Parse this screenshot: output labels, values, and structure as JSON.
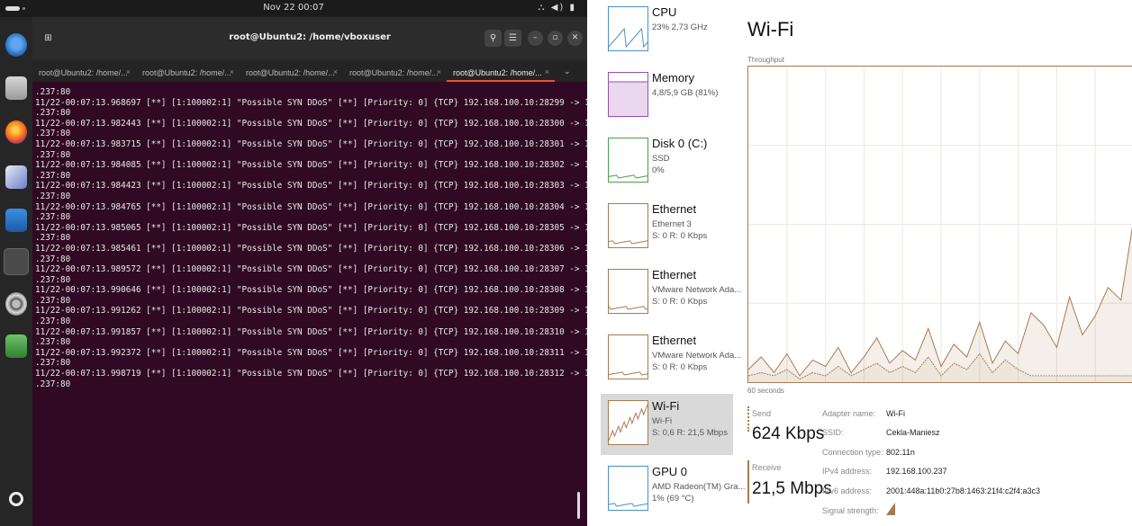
{
  "ubuntu": {
    "clock": "Nov 22 00:07",
    "tray": "⛬ ◀) ▮",
    "window_title": "root@Ubuntu2: /home/vboxuser",
    "tabs": [
      {
        "label": "root@Ubuntu2: /home/...",
        "active": false
      },
      {
        "label": "root@Ubuntu2: /home/...",
        "active": false
      },
      {
        "label": "root@Ubuntu2: /home/...",
        "active": false
      },
      {
        "label": "root@Ubuntu2: /home/...",
        "active": false
      },
      {
        "label": "root@Ubuntu2: /home/...",
        "active": true
      }
    ],
    "tab_more": "⌄",
    "buttons": {
      "newtab": "⊞",
      "search": "⚲",
      "menu": "☰",
      "min": "–",
      "max": "▫",
      "close": "✕"
    },
    "first_line": ".237:80",
    "lines": [
      {
        "ts": "11/22-00:07:13.968697",
        "port": "28299"
      },
      {
        "ts": "11/22-00:07:13.982443",
        "port": "28300"
      },
      {
        "ts": "11/22-00:07:13.983715",
        "port": "28301"
      },
      {
        "ts": "11/22-00:07:13.984085",
        "port": "28302"
      },
      {
        "ts": "11/22-00:07:13.984423",
        "port": "28303"
      },
      {
        "ts": "11/22-00:07:13.984765",
        "port": "28304"
      },
      {
        "ts": "11/22-00:07:13.985065",
        "port": "28305"
      },
      {
        "ts": "11/22-00:07:13.985461",
        "port": "28306"
      },
      {
        "ts": "11/22-00:07:13.989572",
        "port": "28307"
      },
      {
        "ts": "11/22-00:07:13.990646",
        "port": "28308"
      },
      {
        "ts": "11/22-00:07:13.991262",
        "port": "28309"
      },
      {
        "ts": "11/22-00:07:13.991857",
        "port": "28310"
      },
      {
        "ts": "11/22-00:07:13.992372",
        "port": "28311"
      },
      {
        "ts": "11/22-00:07:13.998719",
        "port": "28312"
      }
    ],
    "alert_text": " [**] [1:100002:1] \"Possible SYN DDoS\" [**] [Priority: 0] {TCP} 192.168.100.10:",
    "dest": " -> 192.168.100",
    "cont": ".237:80"
  },
  "taskmgr": {
    "sidebar": [
      {
        "name": "CPU",
        "sub1": "23% 2,73 GHz",
        "sub2": "",
        "color": "#4a90c9",
        "selected": false
      },
      {
        "name": "Memory",
        "sub1": "4,8/5,9 GB (81%)",
        "sub2": "",
        "color": "#9b4fb0",
        "selected": false
      },
      {
        "name": "Disk 0 (C:)",
        "sub1": "SSD",
        "sub2": "0%",
        "color": "#4aa04a",
        "selected": false
      },
      {
        "name": "Ethernet",
        "sub1": "Ethernet 3",
        "sub2": "S: 0 R: 0 Kbps",
        "color": "#a77b50",
        "selected": false
      },
      {
        "name": "Ethernet",
        "sub1": "VMware Network Ada...",
        "sub2": "S: 0 R: 0 Kbps",
        "color": "#a77b50",
        "selected": false
      },
      {
        "name": "Ethernet",
        "sub1": "VMware Network Ada...",
        "sub2": "S: 0 R: 0 Kbps",
        "color": "#a77b50",
        "selected": false
      },
      {
        "name": "Wi-Fi",
        "sub1": "Wi-Fi",
        "sub2": "S: 0,6 R: 21,5 Mbps",
        "color": "#a77b50",
        "selected": true
      },
      {
        "name": "GPU 0",
        "sub1": "AMD Radeon(TM) Gra...",
        "sub2": "1% (69 °C)",
        "color": "#4a90c9",
        "selected": false
      }
    ],
    "title": "Wi-Fi",
    "throughput_label": "Throughput",
    "time_label": "60 seconds",
    "send_label": "Send",
    "send_value": "624 Kbps",
    "receive_label": "Receive",
    "receive_value": "21,5 Mbps",
    "details": [
      {
        "label": "Adapter name:",
        "value": "Wi-Fi"
      },
      {
        "label": "SSID:",
        "value": "Cekla-Maniesz"
      },
      {
        "label": "Connection type:",
        "value": "802.11n"
      },
      {
        "label": "IPv4 address:",
        "value": "192.168.100.237"
      },
      {
        "label": "IPv6 address:",
        "value": "2001:448a:11b0:27b8:1463:21f4:c2f4:a3c3"
      },
      {
        "label": "Signal strength:",
        "value": ""
      }
    ],
    "accent": "#a77b50"
  },
  "chart_data": {
    "type": "area",
    "x": [
      0,
      2,
      4,
      6,
      8,
      10,
      12,
      14,
      16,
      18,
      20,
      22,
      24,
      26,
      28,
      30,
      32,
      34,
      36,
      38,
      40,
      42,
      44,
      46,
      48,
      50,
      52,
      54,
      56,
      58,
      60
    ],
    "series": [
      {
        "values": [
          4,
          8,
          3,
          9,
          2,
          7,
          5,
          11,
          3,
          8,
          14,
          6,
          10,
          7,
          17,
          5,
          12,
          8,
          19,
          6,
          13,
          9,
          22,
          18,
          11,
          27,
          15,
          21,
          30,
          26,
          52
        ]
      },
      {
        "values": [
          2,
          3,
          2,
          4,
          1,
          3,
          2,
          5,
          2,
          4,
          6,
          3,
          5,
          3,
          8,
          2,
          6,
          4,
          9,
          3,
          7,
          4,
          2,
          2,
          2,
          2,
          2,
          2,
          2,
          2,
          2
        ]
      }
    ],
    "ylim": [
      0,
      100
    ],
    "grid": true
  }
}
